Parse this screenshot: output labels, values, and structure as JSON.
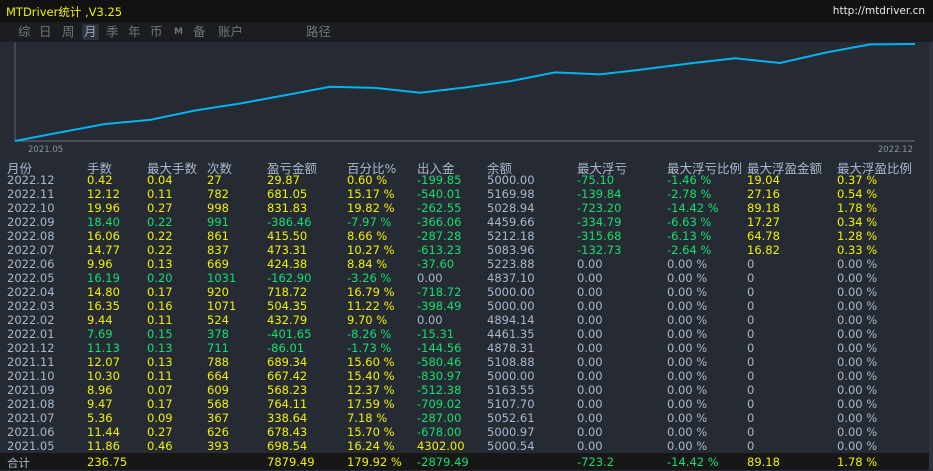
{
  "window": {
    "title": "MTDriver统计 ,V3.25",
    "url": "http://mtdriver.cn"
  },
  "toolbar": {
    "tabs": [
      {
        "label": "综",
        "active": false
      },
      {
        "label": "日",
        "active": false
      },
      {
        "label": "周",
        "active": false
      },
      {
        "label": "月",
        "active": true
      },
      {
        "label": "季",
        "active": false
      },
      {
        "label": "年",
        "active": false
      },
      {
        "label": "币",
        "active": false
      },
      {
        "label": "M",
        "active": false
      },
      {
        "label": "备",
        "active": false
      },
      {
        "label": "账户",
        "active": false
      },
      {
        "label": "路径",
        "active": false
      }
    ]
  },
  "colors": {
    "positive": "#f2f200",
    "negative": "#12e06e",
    "neutral": "#a9b7cd",
    "line": "#00b4f0",
    "background": "#252a33"
  },
  "chart_data": {
    "type": "line",
    "x_start_label": "2021.05",
    "x_end_label": "2022.12",
    "x": [
      "",
      "2021.05",
      "2021.06",
      "2021.07",
      "2021.08",
      "2021.09",
      "2021.10",
      "2021.11",
      "2021.12",
      "2022.01",
      "2022.02",
      "2022.03",
      "2022.04",
      "2022.05",
      "2022.06",
      "2022.07",
      "2022.08",
      "2022.09",
      "2022.10",
      "2022.11",
      "2022.12"
    ],
    "values": [
      0,
      698.54,
      1376.97,
      1715.61,
      2479.72,
      3047.95,
      3715.37,
      4404.71,
      4318.7,
      3917.05,
      4349.84,
      4854.19,
      5572.91,
      5410.01,
      5834.39,
      6307.7,
      6723.2,
      6336.74,
      7168.57,
      7849.62,
      7879.49
    ],
    "ylim": [
      0,
      7879.49
    ],
    "grid": false
  },
  "table": {
    "headers": [
      "月份",
      "手数",
      "最大手数",
      "次数",
      "盈亏金额",
      "百分比%",
      "出入金",
      "余额",
      "最大浮亏",
      "最大浮亏比例",
      "最大浮盈金额",
      "最大浮盈比例"
    ],
    "rows": [
      [
        "2022.12",
        "0.42",
        "0.04",
        "27",
        "29.87",
        "0.60 %",
        "-199.85",
        "5000.00",
        "-75.10",
        "-1.46 %",
        "19.04",
        "0.37 %"
      ],
      [
        "2022.11",
        "12.12",
        "0.11",
        "782",
        "681.05",
        "15.17 %",
        "-540.01",
        "5169.98",
        "-139.84",
        "-2.78 %",
        "27.16",
        "0.54 %"
      ],
      [
        "2022.10",
        "19.96",
        "0.27",
        "998",
        "831.83",
        "19.82 %",
        "-262.55",
        "5028.94",
        "-723.20",
        "-14.42 %",
        "89.18",
        "1.78 %"
      ],
      [
        "2022.09",
        "18.40",
        "0.22",
        "991",
        "-386.46",
        "-7.97 %",
        "-366.06",
        "4459.66",
        "-334.79",
        "-6.63 %",
        "17.27",
        "0.34 %"
      ],
      [
        "2022.08",
        "16.06",
        "0.22",
        "861",
        "415.50",
        "8.66 %",
        "-287.28",
        "5212.18",
        "-315.68",
        "-6.13 %",
        "64.78",
        "1.28 %"
      ],
      [
        "2022.07",
        "14.77",
        "0.22",
        "837",
        "473.31",
        "10.27 %",
        "-613.23",
        "5083.96",
        "-132.73",
        "-2.64 %",
        "16.82",
        "0.33 %"
      ],
      [
        "2022.06",
        "9.96",
        "0.13",
        "669",
        "424.38",
        "8.84 %",
        "-37.60",
        "5223.88",
        "0.00",
        "0.00 %",
        "0",
        "0.00 %"
      ],
      [
        "2022.05",
        "16.19",
        "0.20",
        "1031",
        "-162.90",
        "-3.26 %",
        "0.00",
        "4837.10",
        "0.00",
        "0.00 %",
        "0",
        "0.00 %"
      ],
      [
        "2022.04",
        "14.80",
        "0.17",
        "920",
        "718.72",
        "16.79 %",
        "-718.72",
        "5000.00",
        "0.00",
        "0.00 %",
        "0",
        "0.00 %"
      ],
      [
        "2022.03",
        "16.35",
        "0.16",
        "1071",
        "504.35",
        "11.22 %",
        "-398.49",
        "5000.00",
        "0.00",
        "0.00 %",
        "0",
        "0.00 %"
      ],
      [
        "2022.02",
        "9.44",
        "0.11",
        "524",
        "432.79",
        "9.70 %",
        "0.00",
        "4894.14",
        "0.00",
        "0.00 %",
        "0",
        "0.00 %"
      ],
      [
        "2022.01",
        "7.69",
        "0.15",
        "378",
        "-401.65",
        "-8.26 %",
        "-15.31",
        "4461.35",
        "0.00",
        "0.00 %",
        "0",
        "0.00 %"
      ],
      [
        "2021.12",
        "11.13",
        "0.13",
        "711",
        "-86.01",
        "-1.73 %",
        "-144.56",
        "4878.31",
        "0.00",
        "0.00 %",
        "0",
        "0.00 %"
      ],
      [
        "2021.11",
        "12.07",
        "0.13",
        "788",
        "689.34",
        "15.60 %",
        "-580.46",
        "5108.88",
        "0.00",
        "0.00 %",
        "0",
        "0.00 %"
      ],
      [
        "2021.10",
        "10.30",
        "0.11",
        "664",
        "667.42",
        "15.40 %",
        "-830.97",
        "5000.00",
        "0.00",
        "0.00 %",
        "0",
        "0.00 %"
      ],
      [
        "2021.09",
        "8.96",
        "0.07",
        "609",
        "568.23",
        "12.37 %",
        "-512.38",
        "5163.55",
        "0.00",
        "0.00 %",
        "0",
        "0.00 %"
      ],
      [
        "2021.08",
        "9.47",
        "0.17",
        "568",
        "764.11",
        "17.59 %",
        "-709.02",
        "5107.70",
        "0.00",
        "0.00 %",
        "0",
        "0.00 %"
      ],
      [
        "2021.07",
        "5.36",
        "0.09",
        "367",
        "338.64",
        "7.18 %",
        "-287.00",
        "5052.61",
        "0.00",
        "0.00 %",
        "0",
        "0.00 %"
      ],
      [
        "2021.06",
        "11.44",
        "0.27",
        "626",
        "678.43",
        "15.70 %",
        "-678.00",
        "5000.97",
        "0.00",
        "0.00 %",
        "0",
        "0.00 %"
      ],
      [
        "2021.05",
        "11.86",
        "0.46",
        "393",
        "698.54",
        "16.24 %",
        "4302.00",
        "5000.54",
        "0.00",
        "0.00 %",
        "0",
        "0.00 %"
      ]
    ],
    "total": [
      "合计",
      "236.75",
      "",
      "",
      "7879.49",
      "179.92 %",
      "-2879.49",
      "",
      "-723.2",
      "-14.42 %",
      "89.18",
      "1.78 %"
    ]
  }
}
